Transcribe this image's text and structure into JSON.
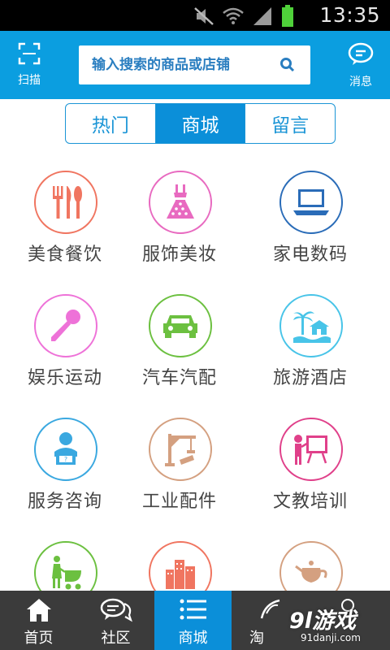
{
  "status_bar": {
    "time": "13:35"
  },
  "header": {
    "scan_label": "扫描",
    "message_label": "消息",
    "search_placeholder": "输入搜索的商品或店铺"
  },
  "tabs": [
    {
      "label": "热门",
      "active": false
    },
    {
      "label": "商城",
      "active": true
    },
    {
      "label": "留言",
      "active": false
    }
  ],
  "categories": [
    {
      "label": "美食餐饮",
      "icon": "cutlery-icon",
      "color": "#f07560"
    },
    {
      "label": "服饰美妆",
      "icon": "dress-icon",
      "color": "#e86ac0"
    },
    {
      "label": "家电数码",
      "icon": "laptop-icon",
      "color": "#2a6cb8"
    },
    {
      "label": "娱乐运动",
      "icon": "microphone-icon",
      "color": "#ee72d8"
    },
    {
      "label": "汽车汽配",
      "icon": "car-icon",
      "color": "#6cc040"
    },
    {
      "label": "旅游酒店",
      "icon": "beach-icon",
      "color": "#48c4e8"
    },
    {
      "label": "服务咨询",
      "icon": "support-agent-icon",
      "color": "#3aa8e0"
    },
    {
      "label": "工业配件",
      "icon": "crane-icon",
      "color": "#d4a080"
    },
    {
      "label": "文教培训",
      "icon": "teacher-board-icon",
      "color": "#e0408a"
    },
    {
      "label": "",
      "icon": "stroller-icon",
      "color": "#6cc040"
    },
    {
      "label": "",
      "icon": "buildings-icon",
      "color": "#f07560"
    },
    {
      "label": "",
      "icon": "teapot-icon",
      "color": "#d4a080"
    }
  ],
  "bottom_nav": [
    {
      "label": "首页",
      "icon": "home-icon",
      "active": false
    },
    {
      "label": "社区",
      "icon": "chat-icon",
      "active": false
    },
    {
      "label": "商城",
      "icon": "list-icon",
      "active": true
    },
    {
      "label": "淘",
      "icon": "leaf-icon",
      "active": false
    },
    {
      "label": "",
      "icon": "more-icon",
      "active": false
    }
  ],
  "watermark": {
    "main": "9l游戏",
    "sub": "91danji.com"
  },
  "colors": {
    "primary": "#0b9ee0",
    "nav_bg": "#3b3b3b",
    "active": "#0b8fd9"
  }
}
